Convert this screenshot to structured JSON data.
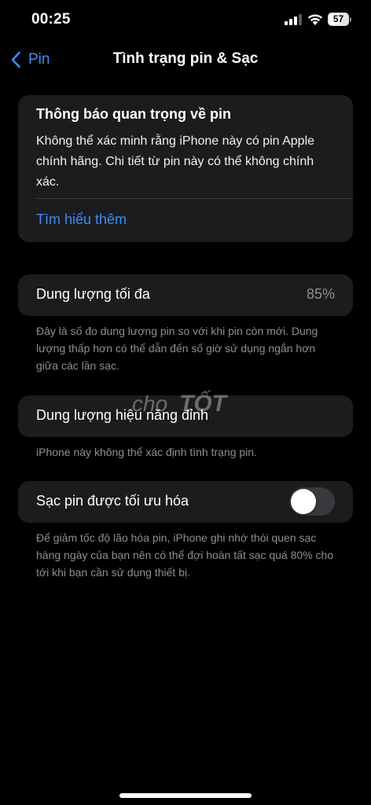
{
  "status_bar": {
    "time": "00:25",
    "battery_percent": "57",
    "battery_level": 0.57,
    "icons": [
      "cellular-signal-icon",
      "wifi-icon",
      "battery-icon"
    ]
  },
  "nav": {
    "back_label": "Pin",
    "title": "Tình trạng pin & Sạc"
  },
  "notice": {
    "title": "Thông báo quan trọng về pin",
    "body": "Không thể xác minh rằng iPhone này có pin Apple chính hãng. Chi tiết từ pin này có thể không chính xác.",
    "link_label": "Tìm hiểu thêm"
  },
  "max_capacity": {
    "label": "Dung lượng tối đa",
    "value": "85%",
    "footnote": "Đây là số đo dung lượng pin so với khi pin còn mới. Dung lượng thấp hơn có thể dẫn đến số giờ sử dụng ngắn hơn giữa các lần sạc."
  },
  "peak_performance": {
    "label": "Dung lượng hiệu năng đỉnh",
    "footnote": "iPhone này không thể xác định tình trạng pin."
  },
  "optimized_charging": {
    "label": "Sạc pin được tối ưu hóa",
    "enabled": false,
    "footnote": "Để giảm tốc độ lão hóa pin, iPhone ghi nhớ thói quen sạc hàng ngày của bạn nên có thể đợi hoàn tất sạc quá 80% cho tới khi bạn cần sử dụng thiết bị."
  },
  "watermark": {
    "text_a": "cho",
    "text_b": "TỐT"
  },
  "colors": {
    "background": "#000000",
    "card": "#1c1c1e",
    "accent_blue": "#3d8cf7",
    "secondary_text": "#8e8e93",
    "toggle_off": "#39393d"
  }
}
